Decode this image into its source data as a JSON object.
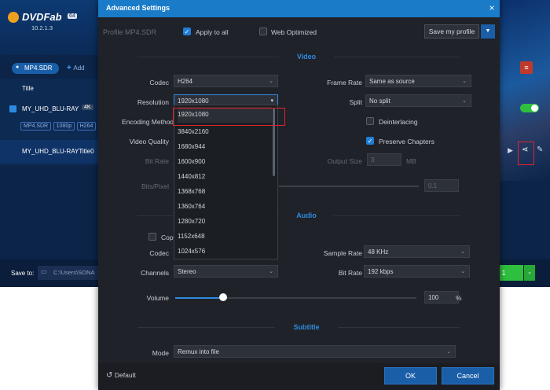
{
  "background_app": {
    "brand": "DVDFab",
    "version_badge": "64",
    "version": "10.2.1.3",
    "profile_chip": "MP4.SDR",
    "add_label": "Add",
    "title_header": "Title",
    "disc_name": "MY_UHD_BLU-RAY",
    "disc_badge": "4K",
    "tags": [
      "MP4.SDR",
      "1080p",
      "H264"
    ],
    "title_item": "MY_UHD_BLU-RAYTitle0",
    "save_to_label": "Save to:",
    "save_path": "C:\\Users\\SONA"
  },
  "dialog": {
    "title": "Advanced Settings",
    "close_glyph": "×",
    "profile_label": "Profile MP4.SDR",
    "apply_to_all": "Apply to all",
    "web_optimized": "Web Optimized",
    "save_profile": "Save my profile",
    "sections": {
      "video": "Video",
      "audio": "Audio",
      "subtitle": "Subtitle"
    },
    "video": {
      "codec_label": "Codec",
      "codec_value": "H264",
      "resolution_label": "Resolution",
      "resolution_value": "1920x1080",
      "encoding_method_label": "Encoding Method",
      "video_quality_label": "Video Quality",
      "bit_rate_label": "Bit Rate",
      "bits_pixel_label": "Bits/Pixel",
      "bits_pixel_value": "0.1",
      "frame_rate_label": "Frame Rate",
      "frame_rate_value": "Same as source",
      "split_label": "Split",
      "split_value": "No split",
      "deinterlacing": "Deinterlacing",
      "preserve_chapters": "Preserve Chapters",
      "output_size_label": "Output Size",
      "output_size_value": "3",
      "output_size_unit": "MB"
    },
    "resolution_options": [
      "1920x1080",
      "3840x2160",
      "1680x944",
      "1600x900",
      "1440x812",
      "1368x768",
      "1360x764",
      "1280x720",
      "1152x648",
      "1024x576"
    ],
    "audio": {
      "copy_label": "Copy",
      "codec_label": "Codec",
      "channels_label": "Channels",
      "channels_value": "Stereo",
      "sample_rate_label": "Sample Rate",
      "sample_rate_value": "48 KHz",
      "bit_rate_label": "Bit Rate",
      "bit_rate_value": "192 kbps",
      "volume_label": "Volume",
      "volume_value": "100",
      "volume_unit": "%",
      "volume_level": 0.2
    },
    "subtitle": {
      "mode_label": "Mode",
      "mode_value": "Remux into file"
    },
    "footer": {
      "default": "Default",
      "ok": "OK",
      "cancel": "Cancel"
    }
  },
  "colors": {
    "titlebar": "#1a7bc9",
    "accent": "#2d8ae0",
    "highlight": "#e0242c",
    "dialog_bg": "#1f2228"
  }
}
